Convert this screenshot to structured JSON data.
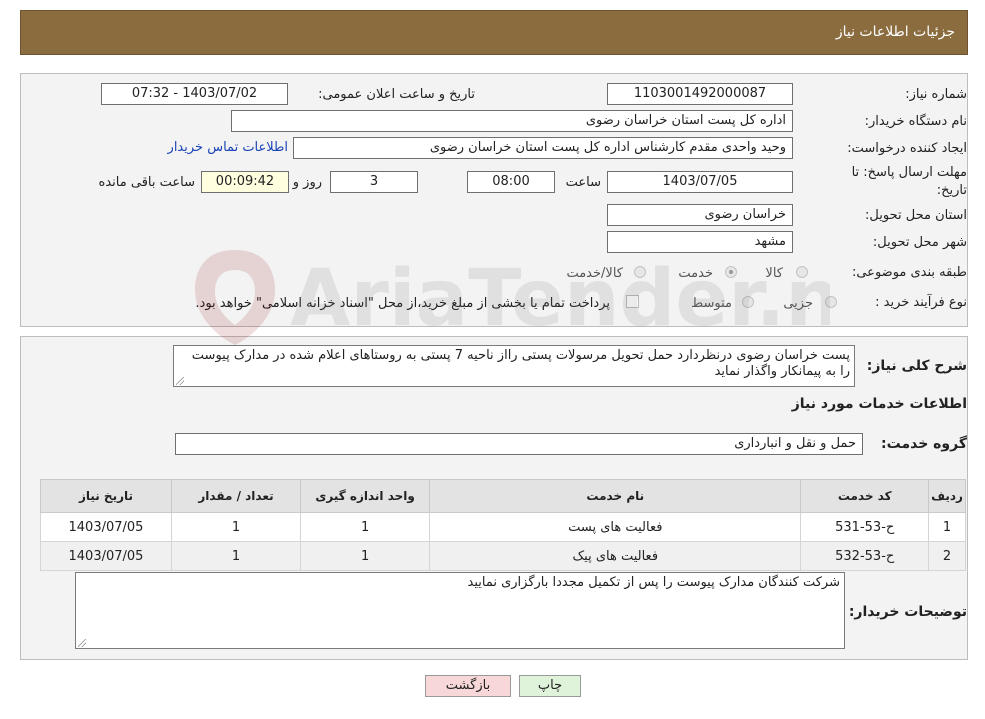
{
  "header": {
    "title": "جزئیات اطلاعات نیاز"
  },
  "fields": {
    "need_number_label": "شماره نیاز:",
    "need_number": "1103001492000087",
    "announce_label": "تاریخ و ساعت اعلان عمومی:",
    "announce_value": "1403/07/02 - 07:32",
    "buyer_org_label": "نام دستگاه خریدار:",
    "buyer_org": "اداره کل پست استان خراسان رضوی",
    "creator_label": "ایجاد کننده درخواست:",
    "creator": "وحید واحدی مقدم کارشناس اداره کل پست استان خراسان رضوی",
    "contact_link": "اطلاعات تماس خریدار",
    "deadline_label_1": "مهلت ارسال پاسخ: تا",
    "deadline_label_2": "تاریخ:",
    "deadline_date": "1403/07/05",
    "time_label": "ساعت",
    "deadline_time": "08:00",
    "days_value": "3",
    "days_label": "روز و",
    "remaining_time": "00:09:42",
    "remaining_label": "ساعت باقی مانده",
    "province_label": "استان محل تحویل:",
    "province": "خراسان رضوی",
    "city_label": "شهر محل تحویل:",
    "city": "مشهد",
    "category_label": "طبقه بندی موضوعی:",
    "category_options": [
      "کالا",
      "خدمت",
      "کالا/خدمت"
    ],
    "purchase_type_label": "نوع فرآیند خرید :",
    "purchase_options": [
      "جزیی",
      "متوسط"
    ],
    "payment_note": "پرداخت تمام یا بخشی از مبلغ خرید،از محل \"اسناد خزانه اسلامی\" خواهد بود."
  },
  "description": {
    "label": "شرح کلی نیاز:",
    "text": "پست خراسان رضوی درنظردارد حمل تحویل مرسولات پستی رااز ناحیه 7 پستی به روستاهای اعلام شده در مدارک پیوست را به پیمانکار واگذار نماید"
  },
  "services": {
    "section_title": "اطلاعات خدمات مورد نیاز",
    "group_label": "گروه خدمت:",
    "group_value": "حمل و نقل و انبارداری",
    "columns": [
      "ردیف",
      "کد خدمت",
      "نام خدمت",
      "واحد اندازه گیری",
      "تعداد / مقدار",
      "تاریخ نیاز"
    ],
    "rows": [
      [
        "1",
        "ح-53-531",
        "فعالیت های پست",
        "1",
        "1",
        "1403/07/05"
      ],
      [
        "2",
        "ح-53-532",
        "فعالیت های پیک",
        "1",
        "1",
        "1403/07/05"
      ]
    ]
  },
  "buyer_notes": {
    "label": "توضیحات خریدار:",
    "text": "شرکت کنندگان مدارک پیوست را پس از تکمیل مجددا بارگزاری نمایید"
  },
  "buttons": {
    "print": "چاپ",
    "back": "بازگشت"
  },
  "watermark": {
    "text": "AriaTender.net"
  },
  "colors": {
    "header_bg": "#8b6c3f",
    "link": "#1a44b8",
    "remaining_bg": "#ffffe0",
    "back_bg": "#f7d7d7",
    "print_bg": "#dff3da"
  }
}
